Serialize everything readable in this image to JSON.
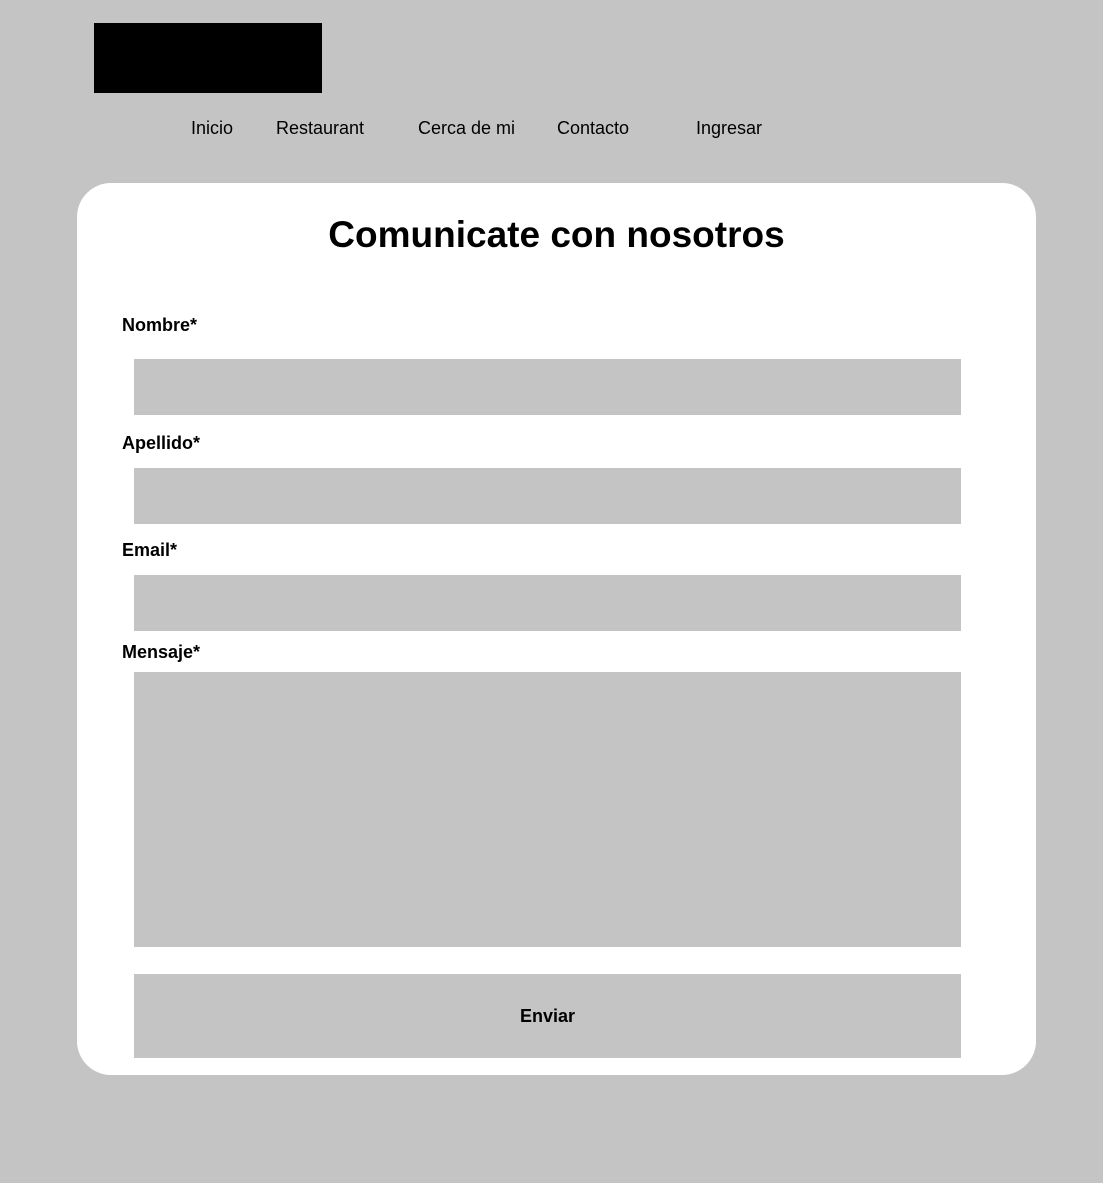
{
  "nav": {
    "items": [
      {
        "label": "Inicio"
      },
      {
        "label": "Restaurant"
      },
      {
        "label": "Cerca de mi"
      },
      {
        "label": "Contacto"
      },
      {
        "label": "Ingresar"
      }
    ]
  },
  "form": {
    "title": "Comunicate con nosotros",
    "fields": {
      "nombre": {
        "label": "Nombre*",
        "value": "",
        "placeholder": ""
      },
      "apellido": {
        "label": "Apellido*",
        "value": "",
        "placeholder": ""
      },
      "email": {
        "label": "Email*",
        "value": "",
        "placeholder": ""
      },
      "mensaje": {
        "label": "Mensaje*",
        "value": "",
        "placeholder": ""
      }
    },
    "submit_label": "Enviar"
  },
  "colors": {
    "page_background": "#c4c4c4",
    "card_background": "#ffffff",
    "logo_fill": "#000000",
    "input_background": "#c4c4c4",
    "text": "#000000"
  }
}
